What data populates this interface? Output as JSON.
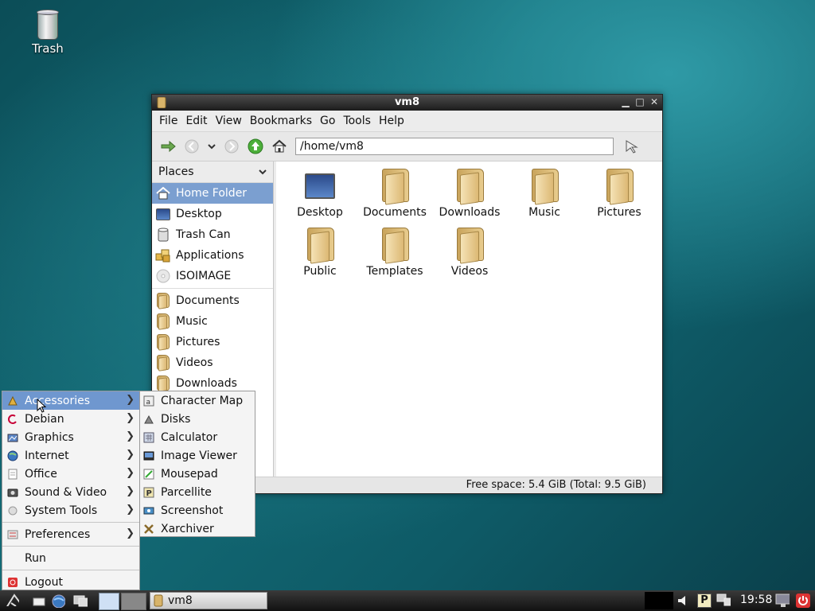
{
  "desktop": {
    "trash_label": "Trash"
  },
  "window": {
    "title": "vm8",
    "menu": [
      "File",
      "Edit",
      "View",
      "Bookmarks",
      "Go",
      "Tools",
      "Help"
    ],
    "address": "/home/vm8",
    "sidebar_header": "Places",
    "places": [
      "Home Folder",
      "Desktop",
      "Trash Can",
      "Applications",
      "ISOIMAGE"
    ],
    "bookmarks": [
      "Documents",
      "Music",
      "Pictures",
      "Videos",
      "Downloads"
    ],
    "files": [
      "Desktop",
      "Documents",
      "Downloads",
      "Music",
      "Pictures",
      "Public",
      "Templates",
      "Videos"
    ],
    "status": "Free space: 5.4 GiB (Total: 9.5 GiB)"
  },
  "app_menu": {
    "categories": [
      "Accessories",
      "Debian",
      "Graphics",
      "Internet",
      "Office",
      "Sound & Video",
      "System Tools"
    ],
    "preferences": "Preferences",
    "run": "Run",
    "logout": "Logout"
  },
  "accessories_submenu": [
    "Character Map",
    "Disks",
    "Calculator",
    "Image Viewer",
    "Mousepad",
    "Parcellite",
    "Screenshot",
    "Xarchiver"
  ],
  "taskbar": {
    "task_label": "vm8",
    "clock": "19:58",
    "parcellite_letter": "P"
  },
  "colors": {
    "selection": "#7b9fd0",
    "menu_selection": "#6f97cf",
    "titlebar": "#1c1c1c"
  }
}
